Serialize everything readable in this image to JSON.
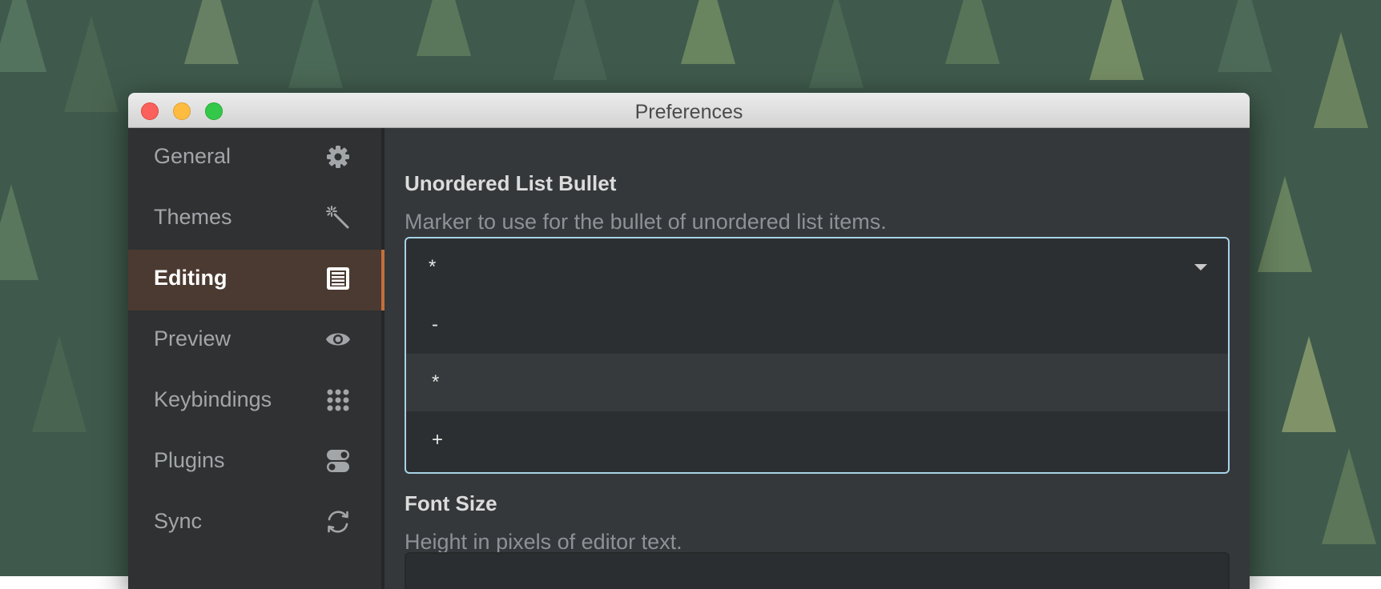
{
  "window": {
    "title": "Preferences"
  },
  "sidebar": {
    "items": [
      {
        "label": "General",
        "icon": "gear-icon"
      },
      {
        "label": "Themes",
        "icon": "magic-wand-icon"
      },
      {
        "label": "Editing",
        "icon": "document-icon",
        "active": true
      },
      {
        "label": "Preview",
        "icon": "eye-icon"
      },
      {
        "label": "Keybindings",
        "icon": "keypad-icon"
      },
      {
        "label": "Plugins",
        "icon": "toggles-icon"
      },
      {
        "label": "Sync",
        "icon": "sync-icon"
      }
    ]
  },
  "main": {
    "bullet": {
      "title": "Unordered List Bullet",
      "description": "Marker to use for the bullet of unordered list items.",
      "selected": "*",
      "options": [
        "-",
        "*",
        "+"
      ],
      "hovered_option": "*"
    },
    "font_size": {
      "title": "Font Size",
      "description": "Height in pixels of editor text."
    }
  },
  "colors": {
    "accent": "#c2703c",
    "active_bg": "#4b3a31",
    "focus_border": "#a6d3e6"
  }
}
